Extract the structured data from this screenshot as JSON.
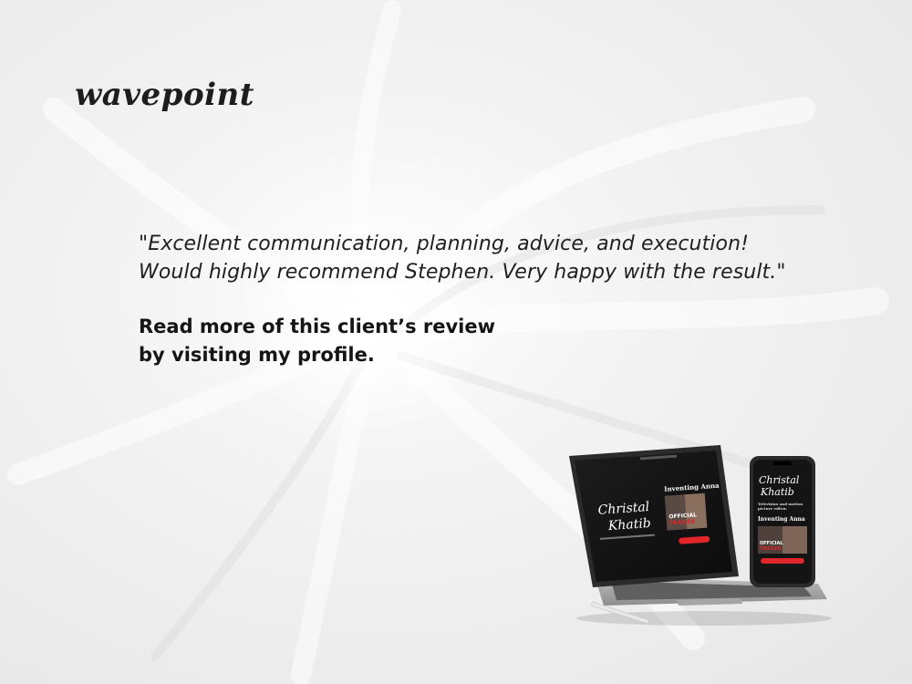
{
  "brand": {
    "logo_text": "wavepoint"
  },
  "testimonial": {
    "quote_line_1": "\"Excellent communication, planning, advice, and execution!",
    "quote_line_2": "Would highly recommend Stephen. Very happy with the result.\""
  },
  "cta": {
    "line_1": "Read more of this client’s review",
    "line_2": "by visiting my profile."
  },
  "mockup": {
    "tablet": {
      "name_line_1": "Christal",
      "name_line_2": "Khatib",
      "project_title": "Inventing Anna",
      "trailer_line_1": "OFFICIAL",
      "trailer_line_2": "TRAILER"
    },
    "phone": {
      "name_line_1": "Christal",
      "name_line_2": "Khatib",
      "tagline_line_1": "Television and motion",
      "tagline_line_2": "picture editor.",
      "project_title": "Inventing Anna",
      "trailer_line_1": "OFFICIAL",
      "trailer_line_2": "TRAILER"
    }
  },
  "colors": {
    "accent_red": "#e0252b",
    "screen_dark": "#141414",
    "text_dark": "#1f1f1f"
  }
}
